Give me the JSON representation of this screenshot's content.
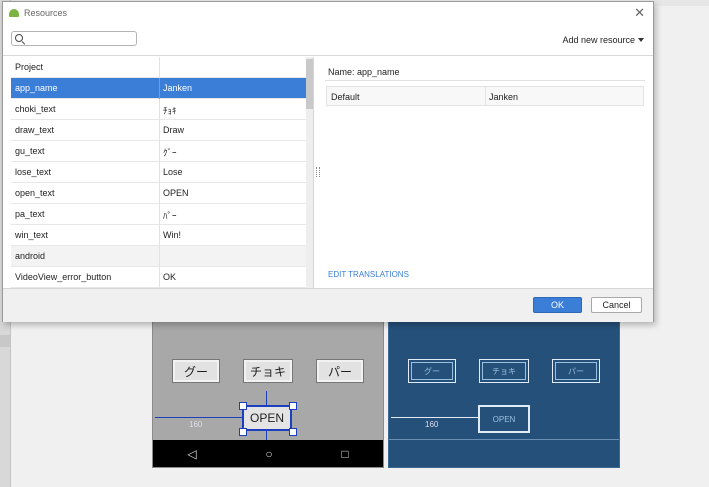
{
  "dialog": {
    "title": "Resources",
    "close_glyph": "✕",
    "search_placeholder": "",
    "search_value": "",
    "add_new_resource": "Add new resource",
    "ok_label": "OK",
    "cancel_label": "Cancel",
    "edit_translations": "EDIT TRANSLATIONS"
  },
  "resources": {
    "project_header": "Project",
    "rows": [
      {
        "key": "app_name",
        "value": "Janken"
      },
      {
        "key": "choki_text",
        "value": "ﾁｮｷ"
      },
      {
        "key": "draw_text",
        "value": "Draw"
      },
      {
        "key": "gu_text",
        "value": "ｸﾞｰ"
      },
      {
        "key": "lose_text",
        "value": "Lose"
      },
      {
        "key": "open_text",
        "value": "OPEN"
      },
      {
        "key": "pa_text",
        "value": "ﾊﾟｰ"
      },
      {
        "key": "win_text",
        "value": "Win!"
      }
    ],
    "group_android": "android",
    "android_rows": [
      {
        "key": "VideoView_error_button",
        "value": "OK"
      }
    ]
  },
  "details": {
    "name_label": "Name:",
    "name_value": "app_name",
    "locale_label": "Default",
    "locale_value": "Janken"
  },
  "preview": {
    "buttons": [
      "グー",
      "チョキ",
      "パー"
    ],
    "open_label": "OPEN",
    "margin_value": "160",
    "nav_icons": [
      "◁",
      "○",
      "□"
    ]
  }
}
